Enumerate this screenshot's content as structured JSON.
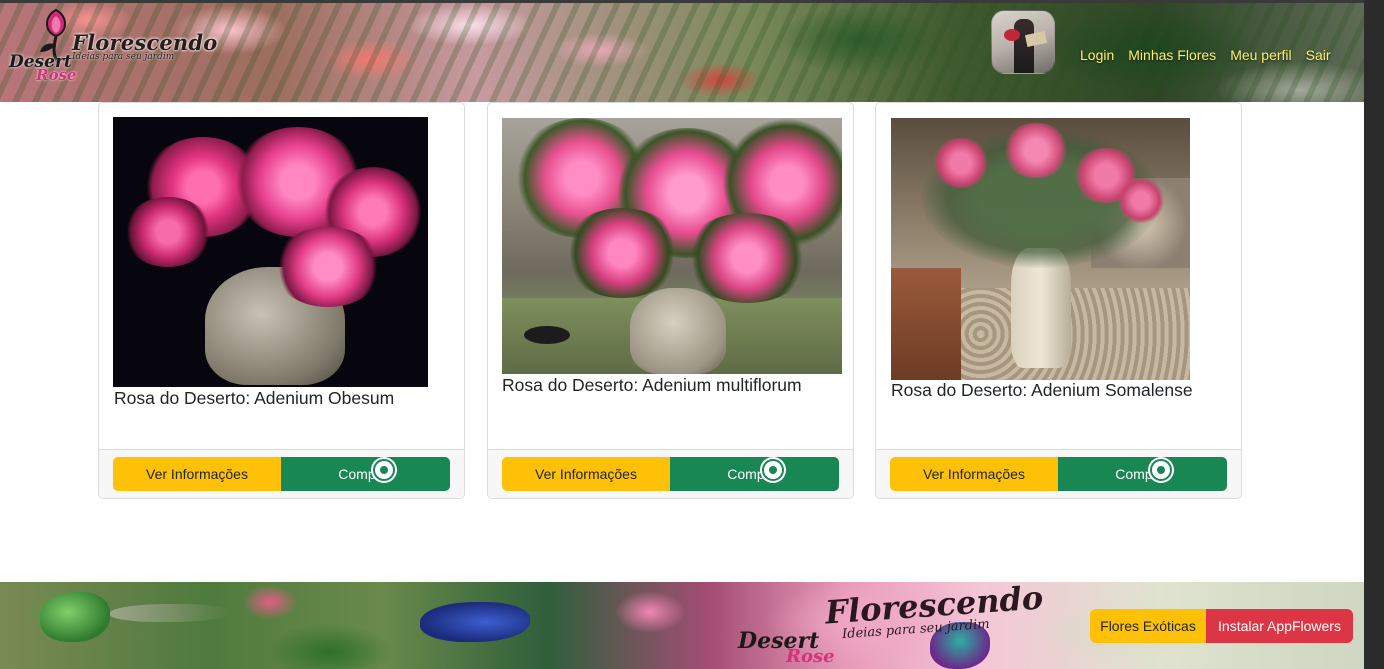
{
  "brand": {
    "logo_main": "Florescendo",
    "logo_tagline": "Ideias para seu jardim",
    "logo_desert": "Desert",
    "logo_rose": "Rose"
  },
  "nav": {
    "items": [
      "Login",
      "Minhas Flores",
      "Meu perfil",
      "Sair"
    ]
  },
  "products": [
    {
      "title": "Rosa do Deserto: Adenium Obesum",
      "info_label": "Ver Informações",
      "buy_label": "Comprar"
    },
    {
      "title": "Rosa do Deserto: Adenium multiflorum",
      "info_label": "Ver Informações",
      "buy_label": "Comprar"
    },
    {
      "title": "Rosa do Deserto: Adenium Somalense",
      "info_label": "Ver Informações",
      "buy_label": "Comprar"
    }
  ],
  "footer": {
    "logo_main": "Florescendo",
    "logo_tagline": "Ideias para seu jardim",
    "logo_desert": "Desert",
    "logo_rose": "Rose",
    "exotic_label": "Flores Exóticas",
    "install_label": "Instalar AppFlowers"
  },
  "colors": {
    "nav_link": "#ffef6b",
    "info_button": "#ffc107",
    "buy_button": "#198754",
    "install_button": "#dc3545"
  },
  "icons": [
    "flower-logo-icon",
    "whatsapp-icon"
  ]
}
